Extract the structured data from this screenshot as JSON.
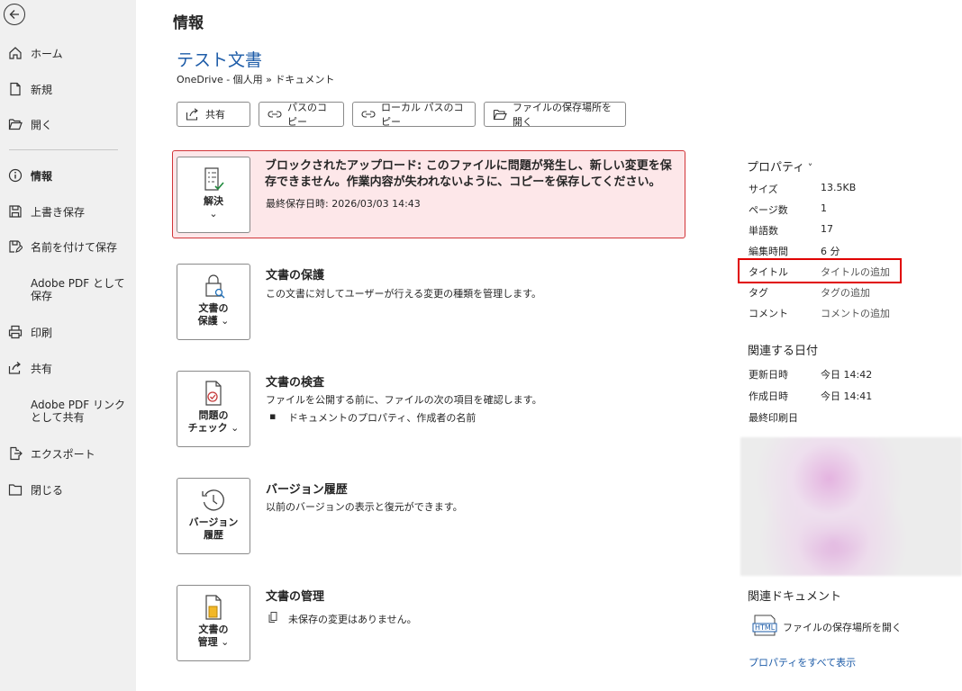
{
  "sidebar": {
    "items": [
      {
        "label": "ホーム"
      },
      {
        "label": "新規"
      },
      {
        "label": "開く"
      },
      {
        "label": "情報"
      },
      {
        "label": "上書き保存"
      },
      {
        "label": "名前を付けて保存"
      },
      {
        "label": "Adobe PDF として\n保存",
        "line1": "Adobe PDF として",
        "line2": "保存"
      },
      {
        "label": "印刷"
      },
      {
        "label": "共有"
      },
      {
        "label": "Adobe PDF リンク\nとして共有",
        "line1": "Adobe PDF リンク",
        "line2": "として共有"
      },
      {
        "label": "エクスポート"
      },
      {
        "label": "閉じる"
      }
    ]
  },
  "header": {
    "title": "情報",
    "doc_title": "テスト文書",
    "path": "OneDrive - 個人用 » ドキュメント"
  },
  "toolbar": {
    "share": "共有",
    "copy_path": "パスのコピー",
    "copy_local_path": "ローカル パスのコピー",
    "open_location": "ファイルの保存場所を開く"
  },
  "alert": {
    "tile_label": "解決",
    "title": "ブロックされたアップロード: このファイルに問題が発生し、新しい変更を保存できません。作業内容が失われないように、コピーを保存してください。",
    "last_saved": "最終保存日時: 2026/03/03 14:43"
  },
  "sections": {
    "protect": {
      "tile_line1": "文書の",
      "tile_line2": "保護",
      "title": "文書の保護",
      "desc": "この文書に対してユーザーが行える変更の種類を管理します。"
    },
    "inspect": {
      "tile_line1": "問題の",
      "tile_line2": "チェック",
      "title": "文書の検査",
      "desc": "ファイルを公開する前に、ファイルの次の項目を確認します。",
      "bullet": "ドキュメントのプロパティ、作成者の名前"
    },
    "versions": {
      "tile_line1": "バージョン",
      "tile_line2": "履歴",
      "title": "バージョン履歴",
      "desc": "以前のバージョンの表示と復元ができます。"
    },
    "manage": {
      "tile_line1": "文書の",
      "tile_line2": "管理",
      "title": "文書の管理",
      "desc": "未保存の変更はありません。"
    }
  },
  "properties": {
    "heading": "プロパティ",
    "items": [
      {
        "key": "サイズ",
        "value": "13.5KB"
      },
      {
        "key": "ページ数",
        "value": "1"
      },
      {
        "key": "単語数",
        "value": "17"
      },
      {
        "key": "編集時間",
        "value": "6 分"
      },
      {
        "key": "タイトル",
        "value": "タイトルの追加"
      },
      {
        "key": "タグ",
        "value": "タグの追加"
      },
      {
        "key": "コメント",
        "value": "コメントの追加"
      }
    ]
  },
  "dates": {
    "heading": "関連する日付",
    "items": [
      {
        "key": "更新日時",
        "value": "今日 14:42"
      },
      {
        "key": "作成日時",
        "value": "今日 14:41"
      },
      {
        "key": "最終印刷日",
        "value": ""
      }
    ]
  },
  "related_docs": {
    "heading": "関連ドキュメント",
    "open_location": "ファイルの保存場所を開く",
    "html_badge": "HTML",
    "show_all": "プロパティをすべて表示"
  },
  "colors": {
    "accent": "#1e5ca8",
    "alert_bg": "#fde7e9",
    "alert_border": "#d13438",
    "highlight": "#e00000"
  }
}
